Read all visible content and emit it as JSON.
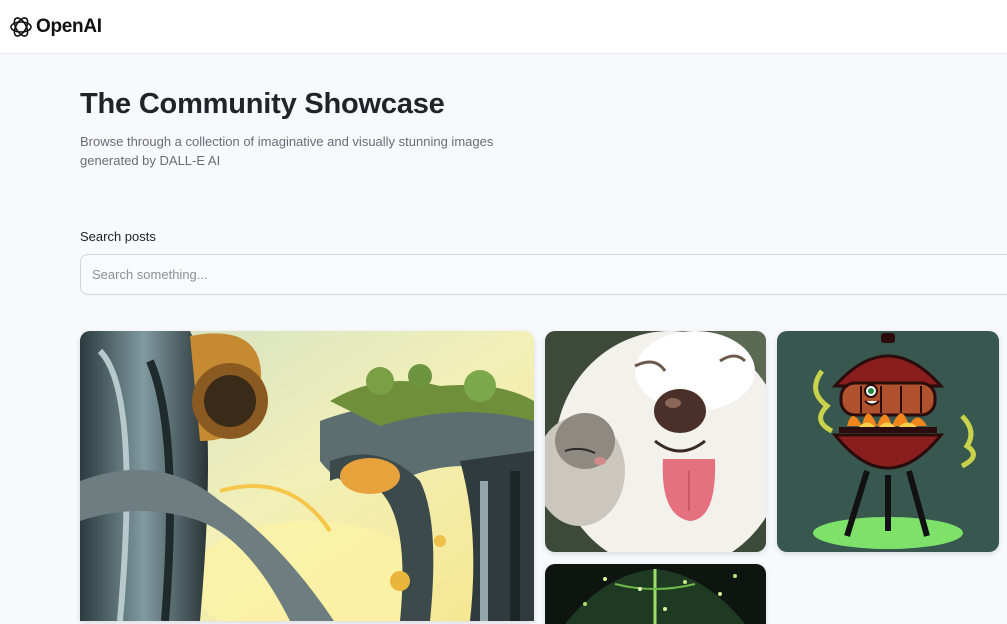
{
  "header": {
    "brand": "OpenAI",
    "logo_icon": "openai-logo-icon"
  },
  "hero": {
    "title": "The Community Showcase",
    "subtitle": "Browse through a collection of imaginative and visually stunning images generated by DALL-E AI"
  },
  "search": {
    "label": "Search posts",
    "placeholder": "Search something...",
    "value": ""
  },
  "gallery": {
    "cards": [
      {
        "subject": "futuristic-organic-architecture"
      },
      {
        "subject": "samoyed-dog-with-cat"
      },
      {
        "subject": "cartoon-bbq-grill-with-sausage"
      },
      {
        "subject": "glowing-forest-night"
      }
    ]
  },
  "colors": {
    "page_bg": "#f8f9fd",
    "header_bg": "#ffffff",
    "title": "#222328",
    "subtitle": "#666e75"
  }
}
